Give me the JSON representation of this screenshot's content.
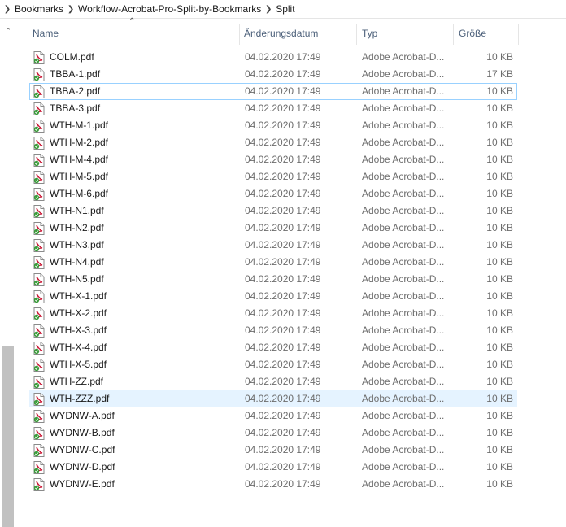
{
  "breadcrumb": [
    "Bookmarks",
    "Workflow-Acrobat-Pro-Split-by-Bookmarks",
    "Split"
  ],
  "columns": {
    "name": "Name",
    "date": "Änderungsdatum",
    "type": "Typ",
    "size": "Größe"
  },
  "files": [
    {
      "name": "COLM.pdf",
      "date": "04.02.2020 17:49",
      "type": "Adobe Acrobat-D...",
      "size": "10 KB"
    },
    {
      "name": "TBBA-1.pdf",
      "date": "04.02.2020 17:49",
      "type": "Adobe Acrobat-D...",
      "size": "17 KB"
    },
    {
      "name": "TBBA-2.pdf",
      "date": "04.02.2020 17:49",
      "type": "Adobe Acrobat-D...",
      "size": "10 KB"
    },
    {
      "name": "TBBA-3.pdf",
      "date": "04.02.2020 17:49",
      "type": "Adobe Acrobat-D...",
      "size": "10 KB"
    },
    {
      "name": "WTH-M-1.pdf",
      "date": "04.02.2020 17:49",
      "type": "Adobe Acrobat-D...",
      "size": "10 KB"
    },
    {
      "name": "WTH-M-2.pdf",
      "date": "04.02.2020 17:49",
      "type": "Adobe Acrobat-D...",
      "size": "10 KB"
    },
    {
      "name": "WTH-M-4.pdf",
      "date": "04.02.2020 17:49",
      "type": "Adobe Acrobat-D...",
      "size": "10 KB"
    },
    {
      "name": "WTH-M-5.pdf",
      "date": "04.02.2020 17:49",
      "type": "Adobe Acrobat-D...",
      "size": "10 KB"
    },
    {
      "name": "WTH-M-6.pdf",
      "date": "04.02.2020 17:49",
      "type": "Adobe Acrobat-D...",
      "size": "10 KB"
    },
    {
      "name": "WTH-N1.pdf",
      "date": "04.02.2020 17:49",
      "type": "Adobe Acrobat-D...",
      "size": "10 KB"
    },
    {
      "name": "WTH-N2.pdf",
      "date": "04.02.2020 17:49",
      "type": "Adobe Acrobat-D...",
      "size": "10 KB"
    },
    {
      "name": "WTH-N3.pdf",
      "date": "04.02.2020 17:49",
      "type": "Adobe Acrobat-D...",
      "size": "10 KB"
    },
    {
      "name": "WTH-N4.pdf",
      "date": "04.02.2020 17:49",
      "type": "Adobe Acrobat-D...",
      "size": "10 KB"
    },
    {
      "name": "WTH-N5.pdf",
      "date": "04.02.2020 17:49",
      "type": "Adobe Acrobat-D...",
      "size": "10 KB"
    },
    {
      "name": "WTH-X-1.pdf",
      "date": "04.02.2020 17:49",
      "type": "Adobe Acrobat-D...",
      "size": "10 KB"
    },
    {
      "name": "WTH-X-2.pdf",
      "date": "04.02.2020 17:49",
      "type": "Adobe Acrobat-D...",
      "size": "10 KB"
    },
    {
      "name": "WTH-X-3.pdf",
      "date": "04.02.2020 17:49",
      "type": "Adobe Acrobat-D...",
      "size": "10 KB"
    },
    {
      "name": "WTH-X-4.pdf",
      "date": "04.02.2020 17:49",
      "type": "Adobe Acrobat-D...",
      "size": "10 KB"
    },
    {
      "name": "WTH-X-5.pdf",
      "date": "04.02.2020 17:49",
      "type": "Adobe Acrobat-D...",
      "size": "10 KB"
    },
    {
      "name": "WTH-ZZ.pdf",
      "date": "04.02.2020 17:49",
      "type": "Adobe Acrobat-D...",
      "size": "10 KB"
    },
    {
      "name": "WTH-ZZZ.pdf",
      "date": "04.02.2020 17:49",
      "type": "Adobe Acrobat-D...",
      "size": "10 KB"
    },
    {
      "name": "WYDNW-A.pdf",
      "date": "04.02.2020 17:49",
      "type": "Adobe Acrobat-D...",
      "size": "10 KB"
    },
    {
      "name": "WYDNW-B.pdf",
      "date": "04.02.2020 17:49",
      "type": "Adobe Acrobat-D...",
      "size": "10 KB"
    },
    {
      "name": "WYDNW-C.pdf",
      "date": "04.02.2020 17:49",
      "type": "Adobe Acrobat-D...",
      "size": "10 KB"
    },
    {
      "name": "WYDNW-D.pdf",
      "date": "04.02.2020 17:49",
      "type": "Adobe Acrobat-D...",
      "size": "10 KB"
    },
    {
      "name": "WYDNW-E.pdf",
      "date": "04.02.2020 17:49",
      "type": "Adobe Acrobat-D...",
      "size": "10 KB"
    }
  ],
  "focused_index": 2,
  "hover_index": 20,
  "icons": {
    "file": "pdf-file-icon",
    "sort": "sort-ascending-icon",
    "separator": "chevron-right-icon",
    "scroll_up": "scroll-up-arrow-icon"
  },
  "colors": {
    "header_text": "#4c607a",
    "hover_bg": "#e5f3ff",
    "focus_border": "#99d1ff",
    "pdf_red": "#c8102e",
    "pdf_badge_green": "#3a9b3a"
  }
}
